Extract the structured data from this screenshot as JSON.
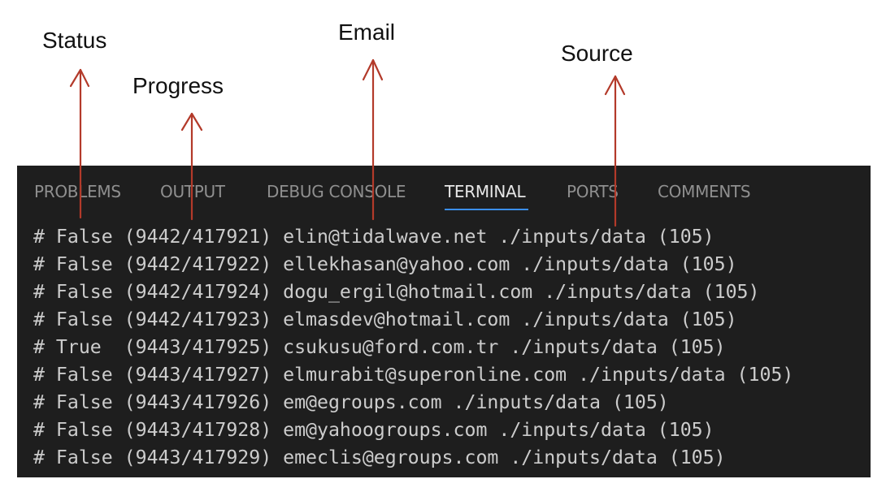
{
  "annotations": {
    "status": "Status",
    "progress": "Progress",
    "email": "Email",
    "source": "Source",
    "arrow_color": "#b33a2a"
  },
  "panel": {
    "background": "#1e1e1e",
    "tabs": [
      {
        "label": "PROBLEMS",
        "active": false
      },
      {
        "label": "OUTPUT",
        "active": false
      },
      {
        "label": "DEBUG CONSOLE",
        "active": false
      },
      {
        "label": "TERMINAL",
        "active": true
      },
      {
        "label": "PORTS",
        "active": false
      },
      {
        "label": "COMMENTS",
        "active": false
      }
    ],
    "active_tab_indicator_color": "#3b8eea"
  },
  "terminal": {
    "lines": [
      "# False (9442/417921) elin@tidalwave.net ./inputs/data (105)",
      "# False (9442/417922) ellekhasan@yahoo.com ./inputs/data (105)",
      "# False (9442/417924) dogu_ergil@hotmail.com ./inputs/data (105)",
      "# False (9442/417923) elmasdev@hotmail.com ./inputs/data (105)",
      "# True  (9443/417925) csukusu@ford.com.tr ./inputs/data (105)",
      "# False (9443/417927) elmurabit@superonline.com ./inputs/data (105)",
      "# False (9443/417926) em@egroups.com ./inputs/data (105)",
      "# False (9443/417928) em@yahoogroups.com ./inputs/data (105)",
      "# False (9443/417929) emeclis@egroups.com ./inputs/data (105)"
    ]
  }
}
